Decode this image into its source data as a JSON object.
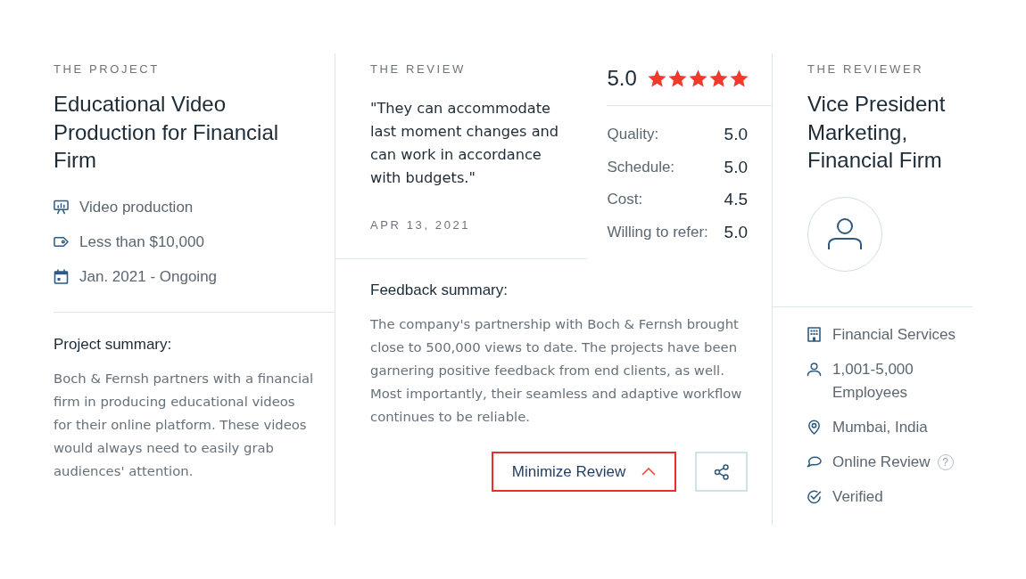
{
  "project": {
    "heading": "THE PROJECT",
    "title": "Educational Video Production for Financial Firm",
    "details": [
      {
        "kind": "service",
        "text": "Video production"
      },
      {
        "kind": "budget",
        "text": "Less than $10,000"
      },
      {
        "kind": "dates",
        "text": "Jan. 2021 - Ongoing"
      }
    ],
    "summary_label": "Project summary:",
    "summary": "Boch & Fernsh partners with a financial firm in producing educational videos for their online platform. These videos would always need to easily grab audiences' attention."
  },
  "review": {
    "heading": "THE REVIEW",
    "quote": "\"They can accommodate last moment changes and can work in accordance with budgets.\"",
    "date": "APR 13, 2021",
    "overall": {
      "score": "5.0",
      "stars": 5
    },
    "ratings": [
      {
        "label": "Quality:",
        "value": "5.0"
      },
      {
        "label": "Schedule:",
        "value": "5.0"
      },
      {
        "label": "Cost:",
        "value": "4.5"
      },
      {
        "label": "Willing to refer:",
        "value": "5.0"
      }
    ],
    "feedback_label": "Feedback summary:",
    "feedback": "The company's partnership with Boch & Fernsh brought close to 500,000 views to date. The projects have been garnering positive feedback from end clients, as well. Most importantly, their seamless and adaptive workflow continues to be reliable.",
    "minimize_button": "Minimize Review"
  },
  "reviewer": {
    "heading": "THE REVIEWER",
    "title": "Vice President Marketing, Financial Firm",
    "details": [
      {
        "kind": "industry",
        "text": "Financial Services"
      },
      {
        "kind": "company_size",
        "text": "1,001-5,000 Employees"
      },
      {
        "kind": "location",
        "text": "Mumbai, India"
      },
      {
        "kind": "review_source",
        "text": "Online Review",
        "help": "?"
      },
      {
        "kind": "verification",
        "text": "Verified"
      }
    ]
  }
}
